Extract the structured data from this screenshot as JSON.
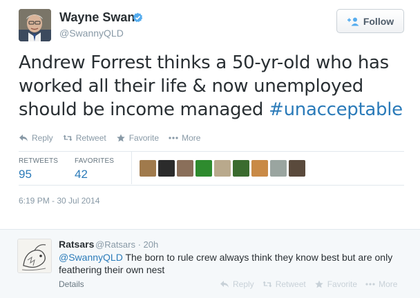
{
  "author": {
    "name": "Wayne Swan",
    "handle": "@SwannyQLD"
  },
  "follow_label": "Follow",
  "tweet": {
    "text": "Andrew Forrest thinks a 50-yr-old who has worked all their life & now unemployed should be income managed ",
    "hashtag": "#unacceptable"
  },
  "actions": {
    "reply": "Reply",
    "retweet": "Retweet",
    "favorite": "Favorite",
    "more": "More"
  },
  "stats": {
    "retweets_label": "RETWEETS",
    "retweets_value": "95",
    "favorites_label": "FAVORITES",
    "favorites_value": "42"
  },
  "favoriters": [
    {
      "color": "#a07a4c"
    },
    {
      "color": "#2b2b2b"
    },
    {
      "color": "#8a6f5a"
    },
    {
      "color": "#2e8b2e"
    },
    {
      "color": "#b9a98c"
    },
    {
      "color": "#3a6b2e"
    },
    {
      "color": "#c98a46"
    },
    {
      "color": "#9aa5a0"
    },
    {
      "color": "#5a4a3c"
    }
  ],
  "timestamp": "6:19 PM - 30 Jul 2014",
  "reply": {
    "name": "Ratsars",
    "handle_time": "@Ratsars · 20h",
    "mention": "@SwannyQLD",
    "text": " The born to rule  crew always think they know best but are only feathering their own nest",
    "details": "Details",
    "actions": {
      "reply": "Reply",
      "retweet": "Retweet",
      "favorite": "Favorite",
      "more": "More"
    }
  },
  "colors": {
    "link": "#2b7bb9",
    "verified": "#55acee",
    "muted": "#8899a6"
  }
}
